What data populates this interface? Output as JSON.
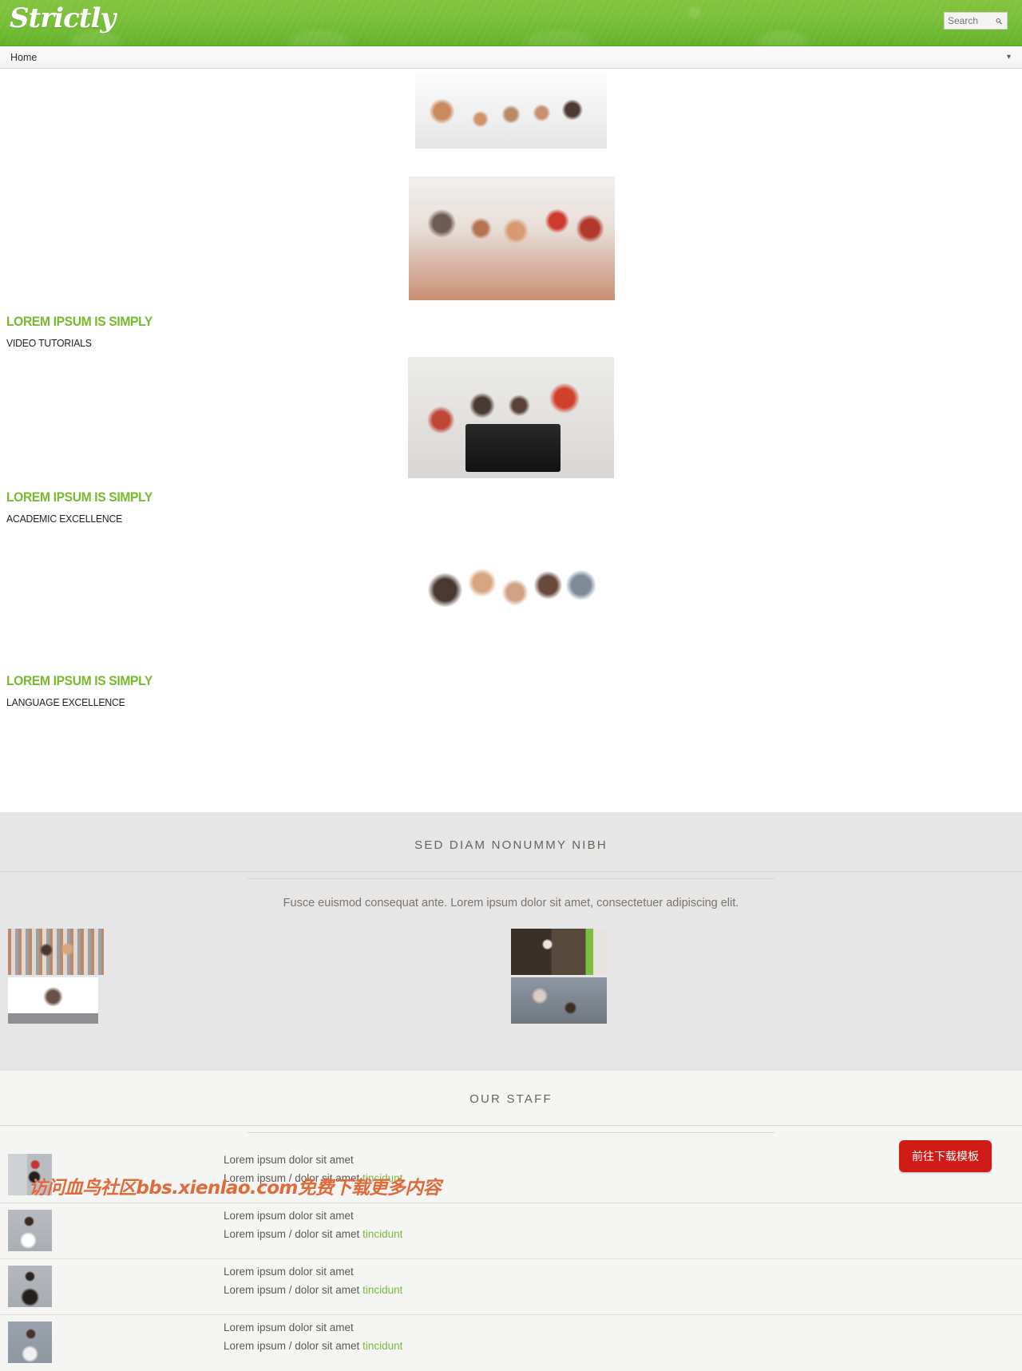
{
  "header": {
    "logo_text": "Strictly",
    "brand_green": "#7dc13c",
    "search": {
      "value": "",
      "placeholder": "Search",
      "icon": "search-icon"
    }
  },
  "nav": {
    "selected_item": "Home",
    "caret_icon": "chevron-down-icon",
    "items": [
      "Home"
    ]
  },
  "banners": [
    {
      "image_name": "team-meeting-photo",
      "title": "",
      "subtitle": ""
    },
    {
      "image_name": "classroom-students-photo",
      "title": "LOREM IPSUM IS SIMPLY",
      "subtitle": "VIDEO TUTORIALS"
    },
    {
      "image_name": "students-laptop-photo",
      "title": "LOREM IPSUM IS SIMPLY",
      "subtitle": "ACADEMIC EXCELLENCE"
    },
    {
      "image_name": "students-group-photo",
      "title": "LOREM IPSUM IS SIMPLY",
      "subtitle": "LANGUAGE EXCELLENCE"
    }
  ],
  "gallery": {
    "title": "SED DIAM NONUMMY NIBH",
    "description": "Fusce euismod consequat ante. Lorem ipsum dolor sit amet, consectetuer adipiscing elit.",
    "thumbs": [
      {
        "image_name": "library-couple-thumb"
      },
      {
        "image_name": "student-books-thumb"
      },
      {
        "image_name": "lecture-hall-thumb"
      },
      {
        "image_name": "raised-hands-thumb"
      }
    ]
  },
  "staff": {
    "title": "OUR STAFF",
    "members": [
      {
        "avatar_name": "staff-avatar-1",
        "name": "Lorem ipsum dolor sit amet",
        "role_prefix": "Lorem ipsum / dolor sit amet ",
        "role_highlight": "tincidunt"
      },
      {
        "avatar_name": "staff-avatar-2",
        "name": "Lorem ipsum dolor sit amet",
        "role_prefix": "Lorem ipsum / dolor sit amet ",
        "role_highlight": "tincidunt"
      },
      {
        "avatar_name": "staff-avatar-3",
        "name": "Lorem ipsum dolor sit amet",
        "role_prefix": "Lorem ipsum / dolor sit amet ",
        "role_highlight": "tincidunt"
      },
      {
        "avatar_name": "staff-avatar-4",
        "name": "Lorem ipsum dolor sit amet",
        "role_prefix": "Lorem ipsum / dolor sit amet ",
        "role_highlight": "tincidunt"
      }
    ]
  },
  "overlay": {
    "download_button_label": "前往下载模板",
    "download_button_color": "#d01b16",
    "watermark_text": "访问血鸟社区bbs.xienlao.com免费下载更多内容",
    "watermark_color": "#e06a3a"
  }
}
